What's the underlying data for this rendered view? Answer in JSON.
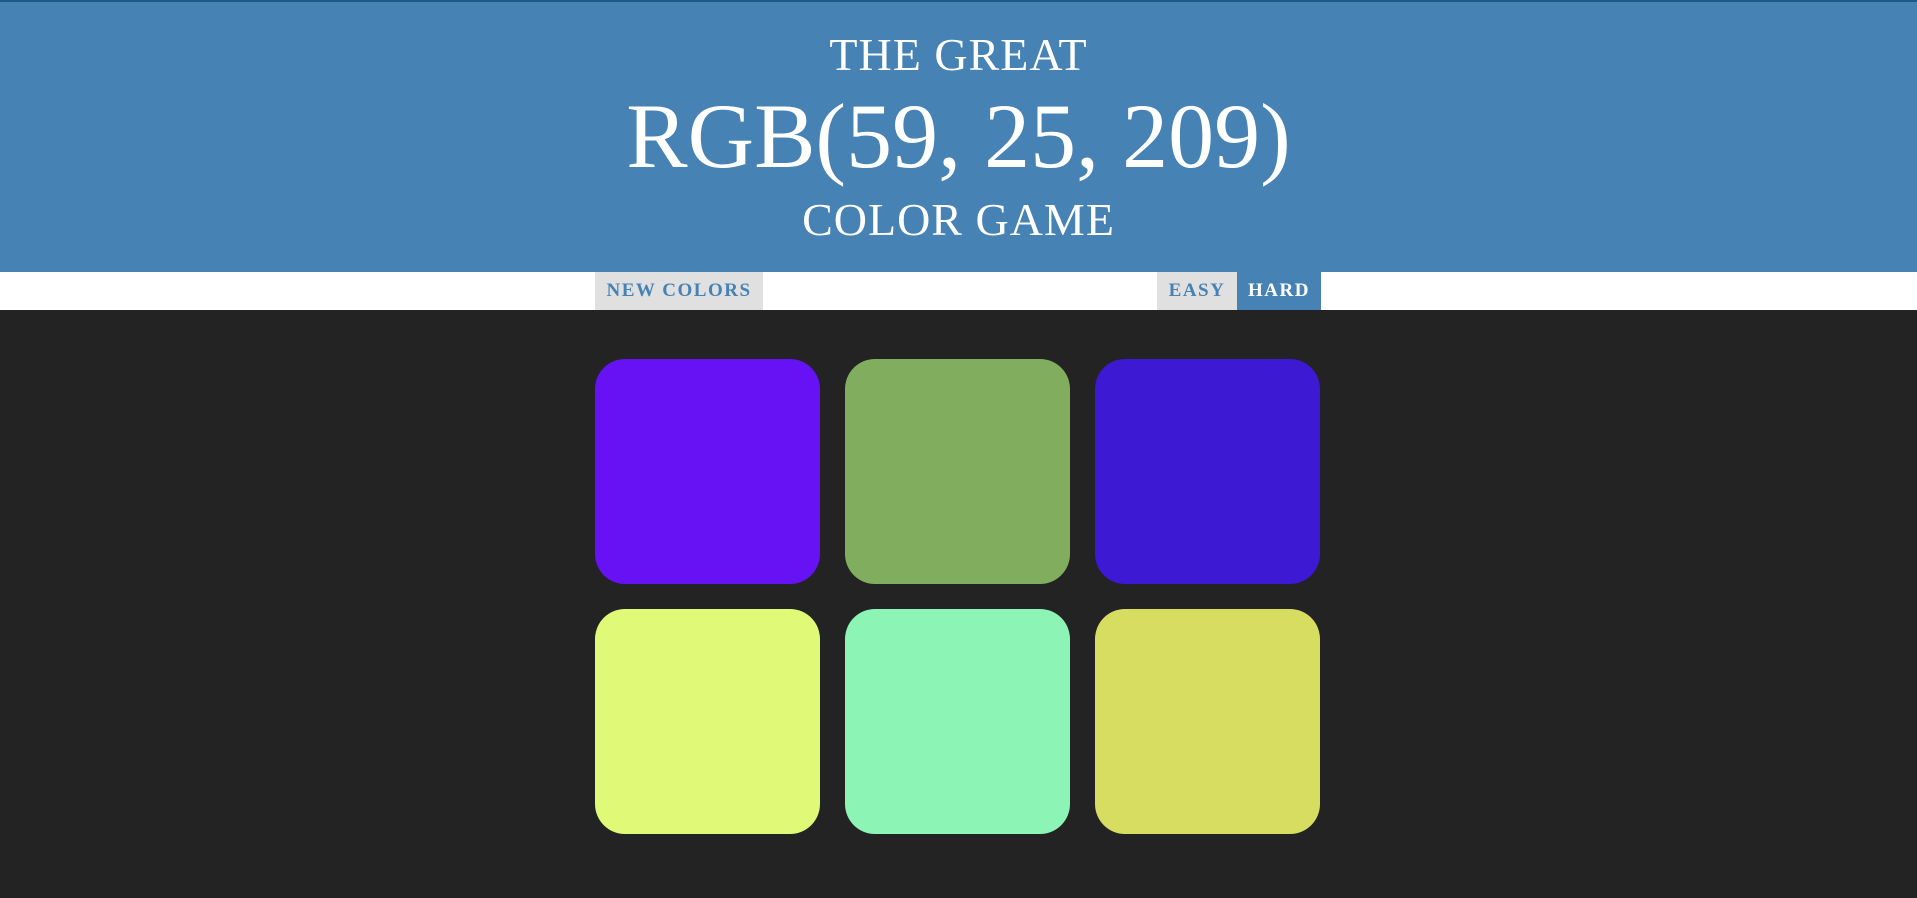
{
  "header": {
    "title_top": "THE GREAT",
    "color_display": "RGB(59, 25, 209)",
    "title_bottom": "COLOR GAME",
    "background": "#4682b4"
  },
  "stripe": {
    "new_colors_label": "NEW COLORS",
    "easy_label": "EASY",
    "hard_label": "HARD",
    "selected_mode": "HARD"
  },
  "squares": [
    {
      "color": "#6612f5"
    },
    {
      "color": "#80ae5e"
    },
    {
      "color": "#3d19d3"
    },
    {
      "color": "#e0f977"
    },
    {
      "color": "#8cf4b5"
    },
    {
      "color": "#d6dd60"
    }
  ],
  "page_background": "#232323"
}
